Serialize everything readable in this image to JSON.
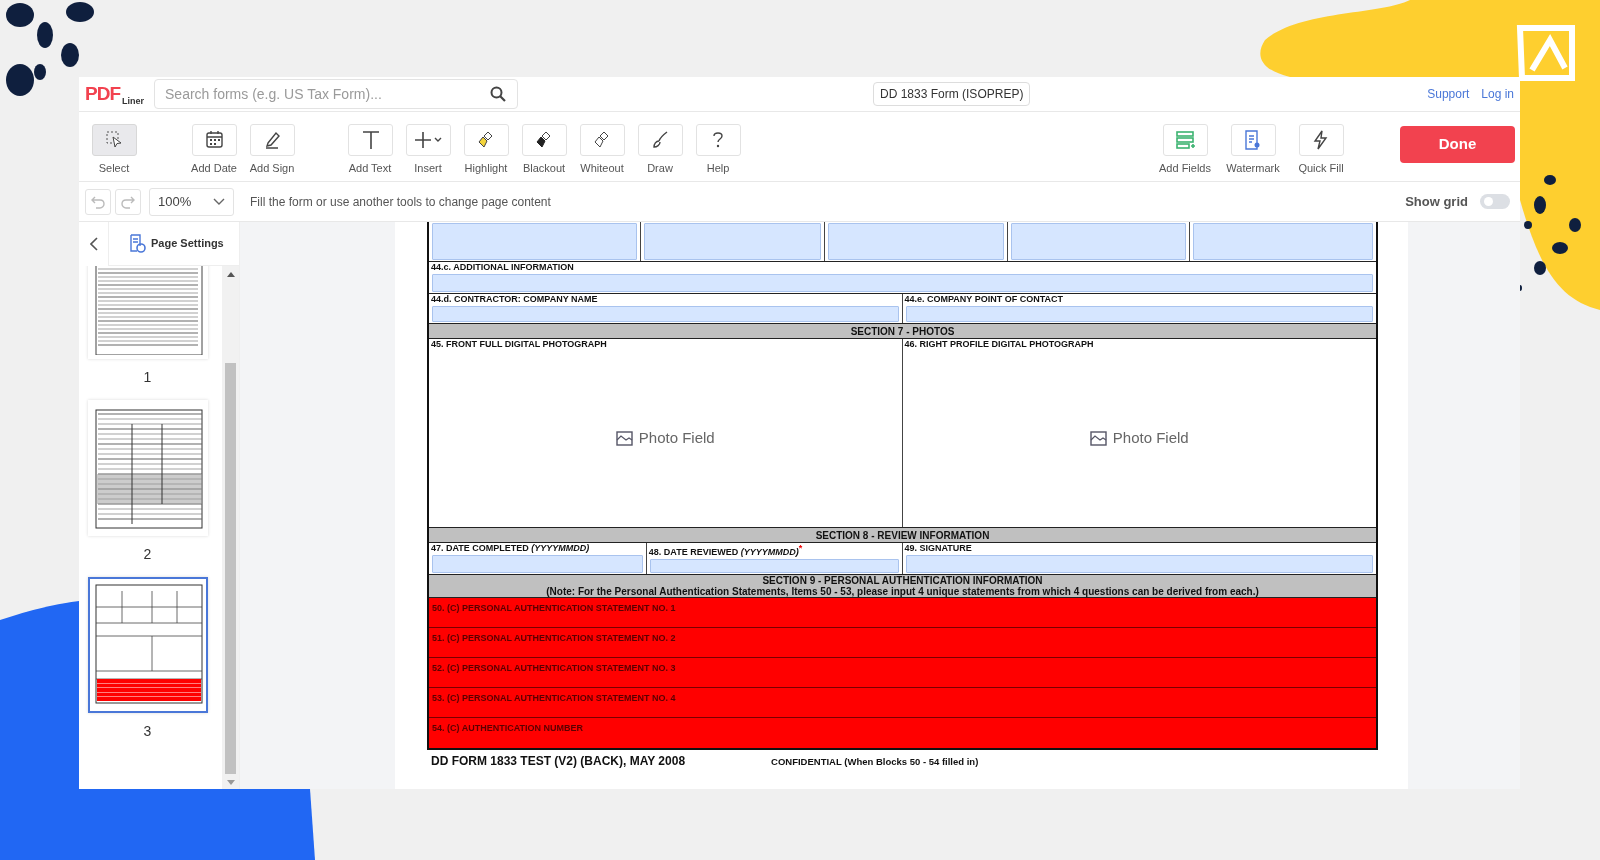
{
  "header": {
    "logo_main": "PDF",
    "logo_sub": "Liner",
    "search": {
      "placeholder": "Search forms (e.g. US Tax Form)..."
    },
    "document_title": "DD 1833 Form (ISOPREP)",
    "links": [
      "Support",
      "Log in"
    ]
  },
  "toolbar": {
    "tools": [
      {
        "label": "Select",
        "selected": true
      },
      {
        "label": "Add Date",
        "selected": false
      },
      {
        "label": "Add Sign",
        "selected": false
      },
      {
        "label": "Add Text",
        "selected": false
      },
      {
        "label": "Insert",
        "selected": false
      },
      {
        "label": "Highlight",
        "selected": false
      },
      {
        "label": "Blackout",
        "selected": false
      },
      {
        "label": "Whiteout",
        "selected": false
      },
      {
        "label": "Draw",
        "selected": false
      },
      {
        "label": "Help",
        "selected": false
      }
    ],
    "right_tools": [
      {
        "label": "Add Fields"
      },
      {
        "label": "Watermark"
      },
      {
        "label": "Quick Fill"
      }
    ],
    "done_button": "Done"
  },
  "subbar": {
    "zoom": "100%",
    "hint": "Fill the form or use another tools to change page content",
    "show_grid": {
      "label": "Show grid",
      "on": false
    }
  },
  "sidebar": {
    "title": "Page Settings",
    "pages": [
      {
        "number": "1",
        "selected": false
      },
      {
        "number": "2",
        "selected": false
      },
      {
        "number": "3",
        "selected": true
      }
    ]
  },
  "form": {
    "rows": [
      {
        "kind": "fields",
        "cells": [
          {
            "kind": "field"
          },
          {
            "kind": "field"
          },
          {
            "kind": "field"
          },
          {
            "kind": "field"
          },
          {
            "kind": "field"
          }
        ]
      },
      {
        "kind": "labeled",
        "cells": [
          {
            "kind": "field",
            "label": "44.c. ADDITIONAL INFORMATION"
          }
        ]
      },
      {
        "kind": "labeled",
        "cells": [
          {
            "kind": "field",
            "label": "44.d. CONTRACTOR: COMPANY NAME"
          },
          {
            "kind": "field",
            "label": "44.e. COMPANY POINT OF CONTACT"
          }
        ]
      },
      {
        "kind": "section",
        "title": "SECTION 7 - PHOTOS"
      },
      {
        "kind": "photos",
        "cells": [
          {
            "kind": "photo",
            "label": "45. FRONT FULL DIGITAL PHOTOGRAPH",
            "placeholder": "Photo Field"
          },
          {
            "kind": "photo",
            "label": "46. RIGHT PROFILE DIGITAL PHOTOGRAPH",
            "placeholder": "Photo Field"
          }
        ]
      },
      {
        "kind": "section",
        "title": "SECTION 8 - REVIEW INFORMATION"
      },
      {
        "kind": "labeled",
        "cells": [
          {
            "kind": "field",
            "label": "47. DATE COMPLETED *(YYYYMMDD)*"
          },
          {
            "kind": "field",
            "label": "48. DATE REVIEWED *(YYYYMMDD)*",
            "required_mark": "*"
          },
          {
            "kind": "field",
            "label": "49. SIGNATURE"
          }
        ]
      },
      {
        "kind": "section",
        "title": "SECTION 9 - PERSONAL AUTHENTICATION INFORMATION",
        "note": "(Note: For the Personal Authentication Statements, Items 50 - 53, please input 4 unique statements from which 4 questions can be derived from each.)"
      },
      {
        "kind": "redacted",
        "label": "50. (C) PERSONAL AUTHENTICATION STATEMENT NO. 1"
      },
      {
        "kind": "redacted",
        "label": "51. (C) PERSONAL AUTHENTICATION STATEMENT NO. 2"
      },
      {
        "kind": "redacted",
        "label": "52. (C) PERSONAL AUTHENTICATION STATEMENT NO. 3"
      },
      {
        "kind": "redacted",
        "label": "53. (C) PERSONAL AUTHENTICATION STATEMENT NO. 4"
      },
      {
        "kind": "redacted",
        "label": "54. (C) AUTHENTICATION NUMBER"
      }
    ],
    "footer_id": "DD FORM 1833 TEST (V2) (BACK), MAY 2008",
    "footer_note": "CONFIDENTIAL (When Blocks 50 - 54 filled in)"
  }
}
